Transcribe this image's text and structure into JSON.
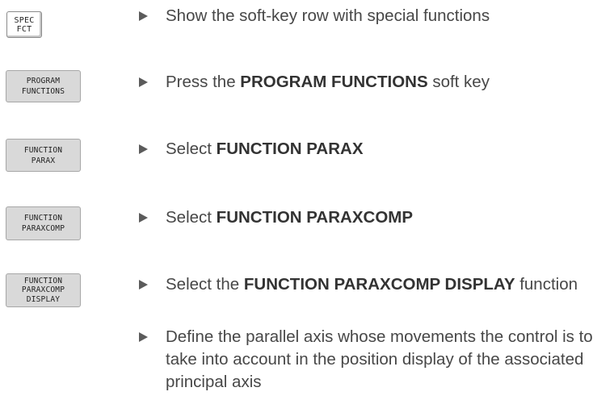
{
  "keys": {
    "spec_fct": [
      "SPEC",
      "FCT"
    ],
    "program_functions": [
      "PROGRAM",
      "FUNCTIONS"
    ],
    "function_parax": [
      "FUNCTION",
      "PARAX"
    ],
    "function_paraxcomp": [
      "FUNCTION",
      "PARAXCOMP"
    ],
    "function_paraxcomp_display": [
      "FUNCTION",
      "PARAXCOMP",
      "DISPLAY"
    ]
  },
  "steps": [
    {
      "text": "Show the soft-key row with special functions"
    },
    {
      "before": "Press the ",
      "bold": "PROGRAM FUNCTIONS",
      "after": " soft key"
    },
    {
      "before": "Select ",
      "bold": "FUNCTION PARAX",
      "after": ""
    },
    {
      "before": "Select ",
      "bold": "FUNCTION PARAXCOMP",
      "after": ""
    },
    {
      "before": "Select the ",
      "bold": "FUNCTION PARAXCOMP DISPLAY",
      "after": " function"
    },
    {
      "text": "Define the parallel axis whose movements the control is to take into account in the position display of the associated principal axis"
    }
  ]
}
